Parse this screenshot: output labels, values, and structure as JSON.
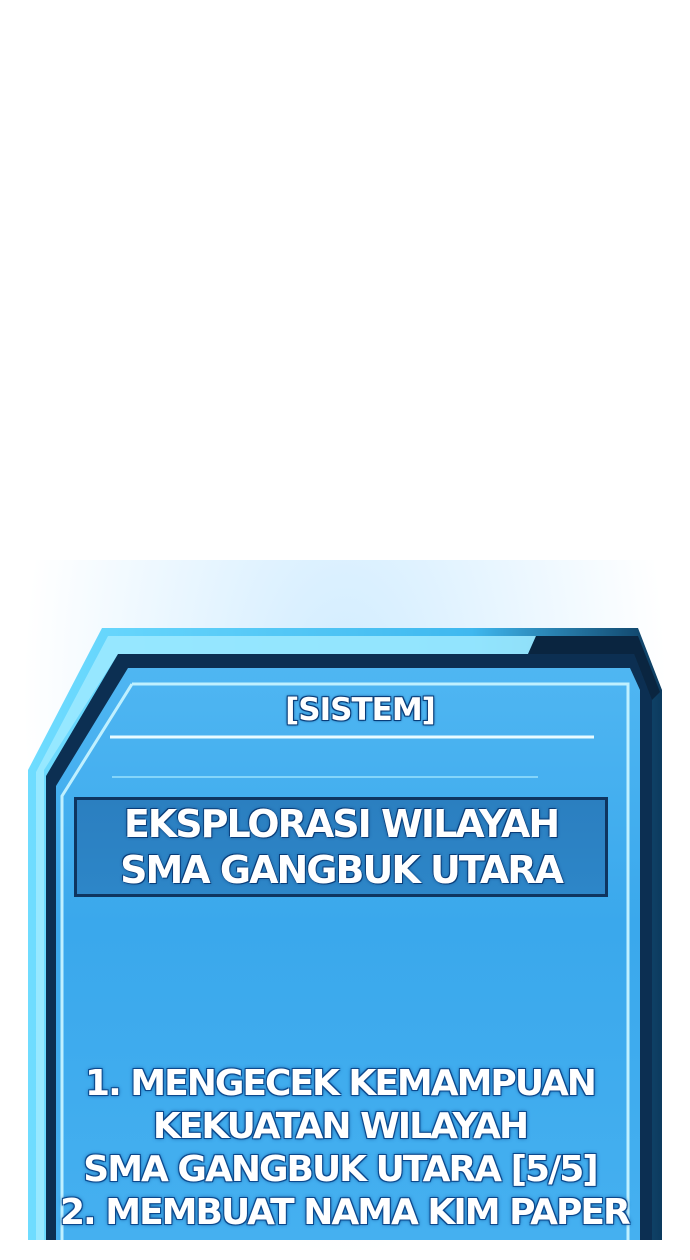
{
  "system_window": {
    "header": "[SISTEM]",
    "quest_title_lines": [
      "EKSPLORASI WILAYAH",
      "SMA GANGBUK UTARA"
    ],
    "task_lines": [
      "1. MENGECEK KEMAMPUAN",
      "KEKUATAN WILAYAH",
      "SMA GANGBUK UTARA  [5/5]",
      "2. MEMBUAT NAMA KIM PAPER"
    ]
  },
  "colors": {
    "frame_dark": "#0a2a4a",
    "frame_light": "#5fd3ff",
    "panel_fill": "#3aa8ec",
    "quest_box": "#2b7fc0"
  }
}
